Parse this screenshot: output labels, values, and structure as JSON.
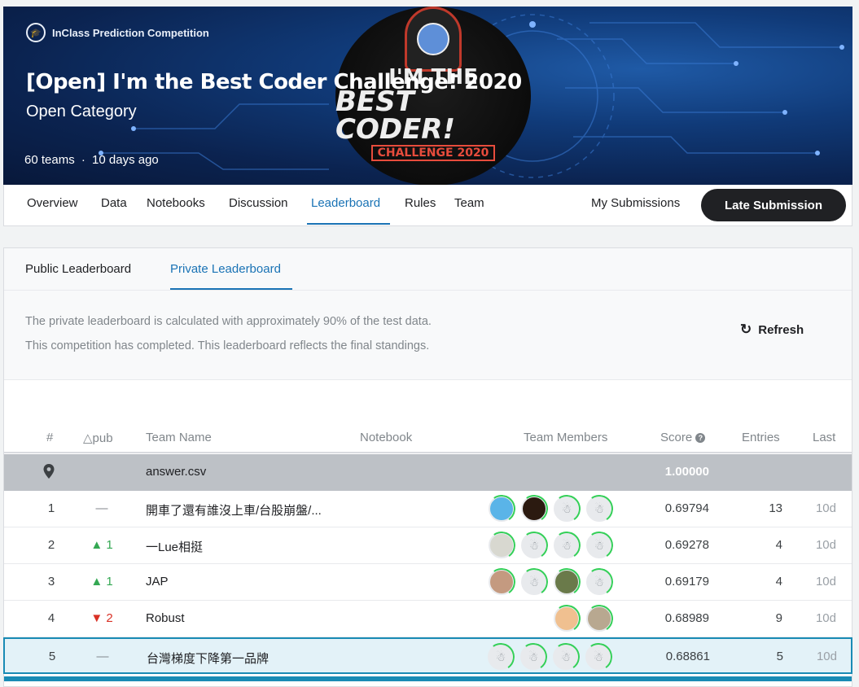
{
  "banner": {
    "badge": "InClass Prediction Competition",
    "title": "[Open] I'm the Best Coder Challenge! 2020",
    "subtitle": "Open Category",
    "teams": "60 teams",
    "separator": "·",
    "ago": "10 days ago",
    "logo_line1": "I'M THE",
    "logo_line2": "BEST CODER!",
    "logo_line3": "CHALLENGE 2020"
  },
  "nav": {
    "tabs": [
      "Overview",
      "Data",
      "Notebooks",
      "Discussion",
      "Leaderboard",
      "Rules",
      "Team"
    ],
    "active_tab": "Leaderboard",
    "my_submissions": "My Submissions",
    "late_submission": "Late Submission"
  },
  "leaderboard": {
    "subtabs": [
      "Public Leaderboard",
      "Private Leaderboard"
    ],
    "active_subtab": "Private Leaderboard",
    "info_line1": "The private leaderboard is calculated with approximately 90% of the test data.",
    "info_line2": "This competition has completed. This leaderboard reflects the final standings.",
    "refresh": "Refresh",
    "headers": {
      "rank": "#",
      "delta": "△pub",
      "team": "Team Name",
      "notebook": "Notebook",
      "members": "Team Members",
      "score": "Score",
      "entries": "Entries",
      "last": "Last"
    },
    "benchmark": {
      "name": "answer.csv",
      "score": "1.00000"
    },
    "rows": [
      {
        "rank": "1",
        "delta": "—",
        "team": "開車了還有誰沒上車/台股崩盤/...",
        "score": "0.69794",
        "entries": "13",
        "last": "10d"
      },
      {
        "rank": "2",
        "delta": "▲ 1",
        "team": "一Lue相挺",
        "score": "0.69278",
        "entries": "4",
        "last": "10d"
      },
      {
        "rank": "3",
        "delta": "▲ 1",
        "team": "JAP",
        "score": "0.69179",
        "entries": "4",
        "last": "10d"
      },
      {
        "rank": "4",
        "delta": "▼ 2",
        "team": "Robust",
        "score": "0.68989",
        "entries": "9",
        "last": "10d"
      },
      {
        "rank": "5",
        "delta": "—",
        "team": "台灣梯度下降第一品牌",
        "score": "0.68861",
        "entries": "5",
        "last": "10d"
      }
    ]
  },
  "colors": {
    "accent": "#1a73b5",
    "up": "#34a853",
    "down": "#d93025",
    "member_ring": "#34d058"
  },
  "icons": [
    "graduation-cap-icon",
    "refresh-icon",
    "question-icon",
    "pin-icon",
    "avatar-icon"
  ]
}
